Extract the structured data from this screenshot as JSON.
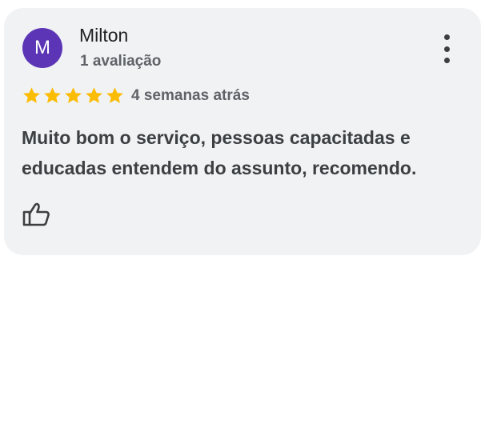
{
  "review": {
    "reviewer": {
      "initial": "M",
      "name": "Milton",
      "review_count": "1 avaliação",
      "avatar_color": "#5b35b5"
    },
    "rating": 5,
    "max_rating": 5,
    "star_color": "#fbbc04",
    "time_ago": "4 semanas atrás",
    "text": "Muito bom o serviço, pessoas capacitadas e educadas entendem do assunto, recomendo.",
    "actions": {
      "more_icon": "more-vertical-icon",
      "like_icon": "thumbs-up-icon"
    }
  }
}
